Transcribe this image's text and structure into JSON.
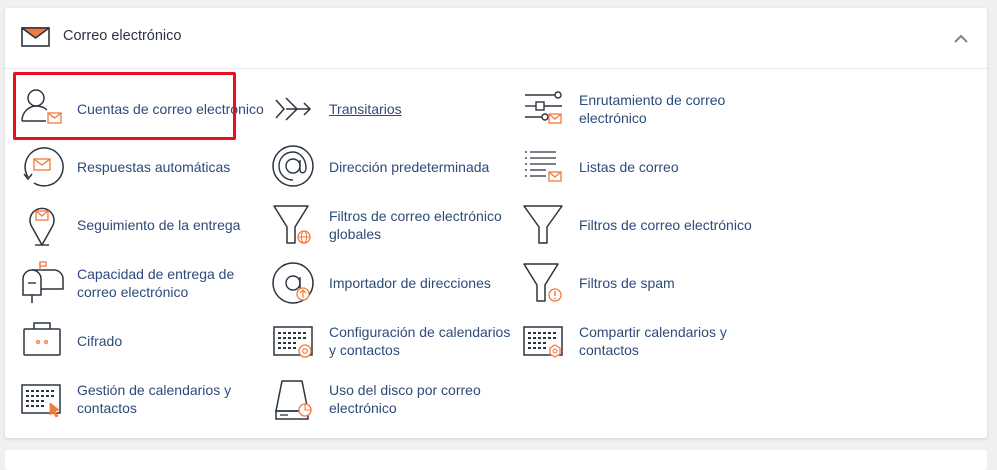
{
  "section": {
    "title": "Correo electrónico",
    "header_icon": "envelope-icon",
    "collapse_icon": "chevron-up-icon"
  },
  "items": [
    {
      "label": "Cuentas de correo electrónico",
      "icon": "email-accounts-icon"
    },
    {
      "label": "Transitarios",
      "icon": "forwarders-icon"
    },
    {
      "label": "Enrutamiento de correo electrónico",
      "icon": "email-routing-icon"
    },
    {
      "label": "Respuestas automáticas",
      "icon": "autoresponders-icon"
    },
    {
      "label": "Dirección predeterminada",
      "icon": "default-address-icon"
    },
    {
      "label": "Listas de correo",
      "icon": "mailing-lists-icon"
    },
    {
      "label": "Seguimiento de la entrega",
      "icon": "track-delivery-icon"
    },
    {
      "label": "Filtros de correo electrónico globales",
      "icon": "global-filters-icon"
    },
    {
      "label": "Filtros de correo electrónico",
      "icon": "email-filters-icon"
    },
    {
      "label": "Capacidad de entrega de correo electrónico",
      "icon": "email-deliverability-icon"
    },
    {
      "label": "Importador de direcciones",
      "icon": "address-importer-icon"
    },
    {
      "label": "Filtros de spam",
      "icon": "spam-filters-icon"
    },
    {
      "label": "Cifrado",
      "icon": "encryption-icon"
    },
    {
      "label": "Configuración de calendarios y contactos",
      "icon": "calendar-config-icon"
    },
    {
      "label": "Compartir calendarios y contactos",
      "icon": "calendar-sharing-icon"
    },
    {
      "label": "Gestión de calendarios y contactos",
      "icon": "calendar-management-icon"
    },
    {
      "label": "Uso del disco por correo electrónico",
      "icon": "disk-usage-icon"
    }
  ],
  "colors": {
    "accent": "#f37a3d",
    "link": "#2d4a7a",
    "highlight": "#e8101c"
  }
}
